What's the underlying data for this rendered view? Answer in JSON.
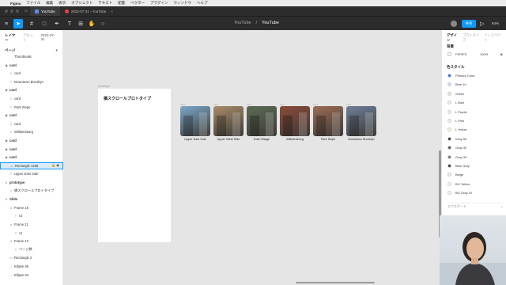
{
  "menubar": {
    "app": "Figma",
    "items": [
      "ファイル",
      "編集",
      "表示",
      "オブジェクト",
      "テキスト",
      "配置",
      "ベクター",
      "プラグイン",
      "ウィンドウ",
      "ヘルプ"
    ]
  },
  "tabs": [
    {
      "label": "YouTube"
    },
    {
      "label": "2022-07-31 - YouTube"
    }
  ],
  "title": {
    "project": "YouTube",
    "file": "YouTube"
  },
  "toolbar": {
    "share": "共有",
    "zoom": "64%"
  },
  "left": {
    "tabs": [
      "レイヤー",
      "アセット"
    ],
    "page_badge": "2022-07-31",
    "pages_header": "ページ",
    "layers": [
      {
        "label": "Thumbnails",
        "type": "page",
        "bold": false,
        "indent": 2
      },
      {
        "label": "card",
        "type": "component",
        "bold": true,
        "indent": 0
      },
      {
        "label": "card",
        "type": "instance",
        "bold": false,
        "indent": 2
      },
      {
        "label": "Downtown Brooklyn",
        "type": "text",
        "bold": false,
        "indent": 2
      },
      {
        "label": "card",
        "type": "component",
        "bold": true,
        "indent": 0
      },
      {
        "label": "card",
        "type": "instance",
        "bold": false,
        "indent": 2
      },
      {
        "label": "Park Slope",
        "type": "text",
        "bold": false,
        "indent": 2
      },
      {
        "label": "card",
        "type": "component",
        "bold": true,
        "indent": 0
      },
      {
        "label": "card",
        "type": "instance",
        "bold": false,
        "indent": 2
      },
      {
        "label": "Williamsburg",
        "type": "text",
        "bold": false,
        "indent": 2
      },
      {
        "label": "card",
        "type": "component",
        "bold": true,
        "indent": 0
      },
      {
        "label": "card",
        "type": "component",
        "bold": true,
        "indent": 0
      },
      {
        "label": "card",
        "type": "component",
        "bold": true,
        "indent": 0
      },
      {
        "label": "Rectangle 1438",
        "type": "rect",
        "bold": false,
        "indent": 2,
        "selected": true
      },
      {
        "label": "Upper East Side",
        "type": "text",
        "bold": false,
        "indent": 2
      },
      {
        "label": "prototype",
        "type": "frame",
        "bold": true,
        "indent": 0
      },
      {
        "label": "横スクロールプロトタイプ",
        "type": "text",
        "bold": false,
        "indent": 2
      },
      {
        "label": "Slide",
        "type": "frame",
        "bold": true,
        "indent": 0
      },
      {
        "label": "Frame 18",
        "type": "frame",
        "bold": false,
        "indent": 2
      },
      {
        "label": "v2",
        "type": "text",
        "bold": false,
        "indent": 4
      },
      {
        "label": "Frame 11",
        "type": "frame",
        "bold": false,
        "indent": 2
      },
      {
        "label": "v1",
        "type": "text",
        "bold": false,
        "indent": 4
      },
      {
        "label": "Frame 12",
        "type": "frame",
        "bold": false,
        "indent": 2
      },
      {
        "label": "ページ数",
        "type": "text",
        "bold": false,
        "indent": 4
      },
      {
        "label": "Rectangle 2",
        "type": "rect",
        "bold": false,
        "indent": 2
      },
      {
        "label": "Ellipse 55",
        "type": "ellipse",
        "bold": false,
        "indent": 2
      },
      {
        "label": "Ellipse 54",
        "type": "ellipse",
        "bold": false,
        "indent": 2
      }
    ]
  },
  "canvas": {
    "frame_label": "prototype",
    "frame_title": "横スクロールプロトタイプ",
    "cards": [
      {
        "label": "card",
        "caption": "Upper East Side",
        "color": "#7aa7c9"
      },
      {
        "label": "card",
        "caption": "Upper West Side",
        "color": "#a88d6a"
      },
      {
        "label": "card",
        "caption": "East Village",
        "color": "#5d6b55"
      },
      {
        "label": "card",
        "caption": "Williamsburg",
        "color": "#8a4b3a"
      },
      {
        "label": "card",
        "caption": "Park Slope",
        "color": "#9b6d55"
      },
      {
        "label": "card",
        "caption": "Downtown Brooklyn",
        "color": "#6f7f9a"
      }
    ]
  },
  "right": {
    "tabs": [
      "デザイン",
      "プロトタイプ",
      "インスペクト"
    ],
    "bg_header": "背景",
    "bg_hex": "F5F5F5",
    "bg_opacity": "100%",
    "styles_header": "色スタイル",
    "swatches": [
      {
        "name": "Primary Color",
        "color": "#2f6ff6"
      },
      {
        "name": "Blue 10",
        "color": "#c8dcff"
      },
      {
        "name": "Green",
        "color": "#d9f2cc"
      },
      {
        "name": "L Blue",
        "color": "#e6f1ff"
      },
      {
        "name": "L Purple",
        "color": "#efe6ff"
      },
      {
        "name": "L Pink",
        "color": "#ffe6ee"
      },
      {
        "name": "L Yellow",
        "color": "#fff3d6"
      },
      {
        "name": "Gray 50",
        "color": "#333333"
      },
      {
        "name": "Gray 40",
        "color": "#555555"
      },
      {
        "name": "Gray 30",
        "color": "#777777"
      },
      {
        "name": "Blue Gray",
        "color": "#2b3a4a"
      },
      {
        "name": "Beige",
        "color": "#f3ead9"
      },
      {
        "name": "BG Yellow",
        "color": "#fffbe8"
      },
      {
        "name": "BG Gray 10",
        "color": "#f5f5f5"
      }
    ],
    "export_label": "エクスポート"
  }
}
